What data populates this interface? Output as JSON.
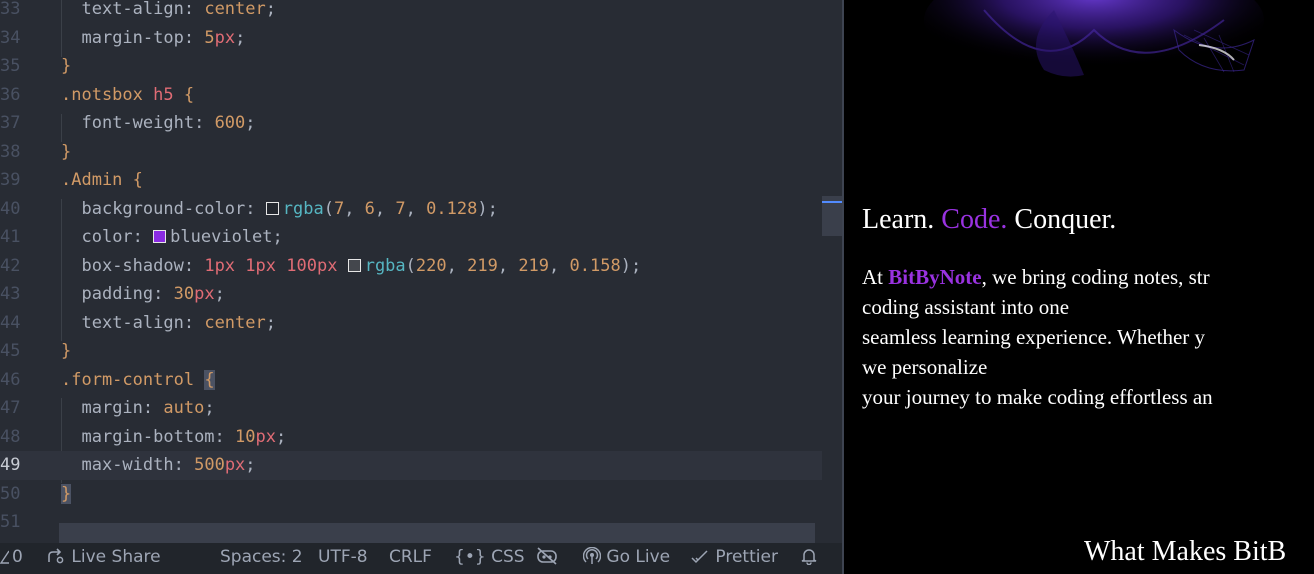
{
  "editor": {
    "lines": [
      {
        "n": "33",
        "tokens": [
          {
            "t": "  "
          },
          {
            "t": "text-align",
            "c": "c-prop"
          },
          {
            "t": ": ",
            "c": "c-p"
          },
          {
            "t": "center",
            "c": "c-kw"
          },
          {
            "t": ";",
            "c": "c-p"
          }
        ]
      },
      {
        "n": "34",
        "tokens": [
          {
            "t": "  "
          },
          {
            "t": "margin-top",
            "c": "c-prop"
          },
          {
            "t": ": ",
            "c": "c-p"
          },
          {
            "t": "5",
            "c": "c-num"
          },
          {
            "t": "px",
            "c": "c-unit"
          },
          {
            "t": ";",
            "c": "c-p"
          }
        ]
      },
      {
        "n": "35",
        "tokens": [
          {
            "t": "}",
            "c": "c-brace"
          }
        ]
      },
      {
        "n": "36",
        "tokens": [
          {
            "t": ".notsbox",
            "c": "c-sel"
          },
          {
            "t": " "
          },
          {
            "t": "h5",
            "c": "c-tag"
          },
          {
            "t": " "
          },
          {
            "t": "{",
            "c": "c-brace"
          }
        ]
      },
      {
        "n": "37",
        "tokens": [
          {
            "t": "  "
          },
          {
            "t": "font-weight",
            "c": "c-prop"
          },
          {
            "t": ": ",
            "c": "c-p"
          },
          {
            "t": "600",
            "c": "c-num"
          },
          {
            "t": ";",
            "c": "c-p"
          }
        ]
      },
      {
        "n": "38",
        "tokens": [
          {
            "t": "}",
            "c": "c-brace"
          }
        ]
      },
      {
        "n": "39",
        "tokens": [
          {
            "t": ".Admin",
            "c": "c-sel"
          },
          {
            "t": " "
          },
          {
            "t": "{",
            "c": "c-brace"
          }
        ]
      },
      {
        "n": "40",
        "tokens": [
          {
            "t": "  "
          },
          {
            "t": "background-color",
            "c": "c-prop"
          },
          {
            "t": ": ",
            "c": "c-p"
          },
          {
            "swatch": "rgba(7,6,7,0.128)"
          },
          {
            "t": "rgba",
            "c": "c-fn"
          },
          {
            "t": "(",
            "c": "c-p"
          },
          {
            "t": "7",
            "c": "c-num"
          },
          {
            "t": ", ",
            "c": "c-p"
          },
          {
            "t": "6",
            "c": "c-num"
          },
          {
            "t": ", ",
            "c": "c-p"
          },
          {
            "t": "7",
            "c": "c-num"
          },
          {
            "t": ", ",
            "c": "c-p"
          },
          {
            "t": "0.128",
            "c": "c-num"
          },
          {
            "t": ");",
            "c": "c-p"
          }
        ]
      },
      {
        "n": "41",
        "tokens": [
          {
            "t": "  "
          },
          {
            "t": "color",
            "c": "c-prop"
          },
          {
            "t": ": ",
            "c": "c-p"
          },
          {
            "swatch": "#8a2be2"
          },
          {
            "t": "blueviolet",
            "c": "c-p"
          },
          {
            "t": ";",
            "c": "c-p"
          }
        ]
      },
      {
        "n": "42",
        "tokens": [
          {
            "t": "  "
          },
          {
            "t": "box-shadow",
            "c": "c-prop"
          },
          {
            "t": ": ",
            "c": "c-p"
          },
          {
            "t": "1px",
            "c": "c-unit"
          },
          {
            "t": " "
          },
          {
            "t": "1px",
            "c": "c-unit"
          },
          {
            "t": " "
          },
          {
            "t": "100px",
            "c": "c-unit"
          },
          {
            "t": " "
          },
          {
            "swatch": "rgba(220,219,219,0.158)"
          },
          {
            "t": "rgba",
            "c": "c-fn"
          },
          {
            "t": "(",
            "c": "c-p"
          },
          {
            "t": "220",
            "c": "c-num"
          },
          {
            "t": ", ",
            "c": "c-p"
          },
          {
            "t": "219",
            "c": "c-num"
          },
          {
            "t": ", ",
            "c": "c-p"
          },
          {
            "t": "219",
            "c": "c-num"
          },
          {
            "t": ", ",
            "c": "c-p"
          },
          {
            "t": "0.158",
            "c": "c-num"
          },
          {
            "t": ");",
            "c": "c-p"
          }
        ]
      },
      {
        "n": "43",
        "tokens": [
          {
            "t": "  "
          },
          {
            "t": "padding",
            "c": "c-prop"
          },
          {
            "t": ": ",
            "c": "c-p"
          },
          {
            "t": "30",
            "c": "c-num"
          },
          {
            "t": "px",
            "c": "c-unit"
          },
          {
            "t": ";",
            "c": "c-p"
          }
        ]
      },
      {
        "n": "44",
        "tokens": [
          {
            "t": "  "
          },
          {
            "t": "text-align",
            "c": "c-prop"
          },
          {
            "t": ": ",
            "c": "c-p"
          },
          {
            "t": "center",
            "c": "c-kw"
          },
          {
            "t": ";",
            "c": "c-p"
          }
        ]
      },
      {
        "n": "45",
        "tokens": [
          {
            "t": "}",
            "c": "c-brace"
          }
        ]
      },
      {
        "n": "46",
        "tokens": [
          {
            "t": ".form-control",
            "c": "c-sel"
          },
          {
            "t": " "
          },
          {
            "t": "{",
            "c": "c-brace-hl"
          }
        ]
      },
      {
        "n": "47",
        "tokens": [
          {
            "t": "  "
          },
          {
            "t": "margin",
            "c": "c-prop"
          },
          {
            "t": ": ",
            "c": "c-p"
          },
          {
            "t": "auto",
            "c": "c-kw"
          },
          {
            "t": ";",
            "c": "c-p"
          }
        ]
      },
      {
        "n": "48",
        "tokens": [
          {
            "t": "  "
          },
          {
            "t": "margin-bottom",
            "c": "c-prop"
          },
          {
            "t": ": ",
            "c": "c-p"
          },
          {
            "t": "10",
            "c": "c-num"
          },
          {
            "t": "px",
            "c": "c-unit"
          },
          {
            "t": ";",
            "c": "c-p"
          }
        ]
      },
      {
        "n": "49",
        "active": true,
        "tokens": [
          {
            "t": "  "
          },
          {
            "t": "max-width",
            "c": "c-prop"
          },
          {
            "t": ": ",
            "c": "c-p"
          },
          {
            "t": "500",
            "c": "c-num"
          },
          {
            "t": "px",
            "c": "c-unit"
          },
          {
            "t": ";",
            "c": "c-p"
          }
        ]
      },
      {
        "n": "50",
        "tokens": [
          {
            "t": "}",
            "c": "c-brace-hl"
          }
        ]
      },
      {
        "n": "51",
        "tokens": []
      }
    ]
  },
  "statusbar": {
    "warnings": "0",
    "live_share": "Live Share",
    "spaces": "Spaces: 2",
    "encoding": "UTF-8",
    "eol": "CRLF",
    "language": "CSS",
    "go_live": "Go Live",
    "prettier": "Prettier"
  },
  "preview": {
    "heading_1": "Learn. ",
    "heading_accent": "Code.",
    "heading_2": " Conquer.",
    "para_at": "At ",
    "para_brand": "BitByNote",
    "para_l1_rest": ", we bring coding notes, str",
    "para_l2": "coding assistant into one",
    "para_l3": "seamless learning experience. Whether y",
    "para_l4": "we personalize",
    "para_l5": "your journey to make coding effortless an",
    "sub_heading": "What Makes BitB",
    "accent_color": "#9932e0"
  },
  "icons": [
    "warning-icon",
    "live-share-icon",
    "braces-icon",
    "copilot-icon",
    "go-live-icon",
    "prettier-check-icon",
    "bell-icon",
    "color-swatch"
  ]
}
